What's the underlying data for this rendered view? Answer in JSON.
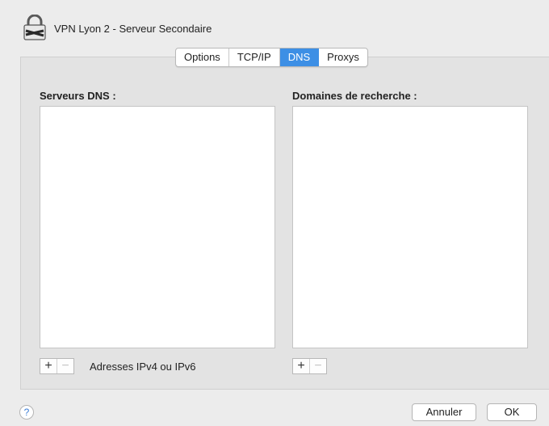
{
  "window": {
    "title": "VPN Lyon 2 - Serveur Secondaire"
  },
  "tabs": [
    {
      "label": "Options",
      "active": false
    },
    {
      "label": "TCP/IP",
      "active": false
    },
    {
      "label": "DNS",
      "active": true
    },
    {
      "label": "Proxys",
      "active": false
    }
  ],
  "dns_servers": {
    "label": "Serveurs DNS :",
    "items": [],
    "add_symbol": "+",
    "remove_symbol": "−",
    "hint": "Adresses IPv4 ou IPv6"
  },
  "search_domains": {
    "label": "Domaines de recherche :",
    "items": [],
    "add_symbol": "+",
    "remove_symbol": "−"
  },
  "footer": {
    "help_symbol": "?",
    "cancel_label": "Annuler",
    "ok_label": "OK"
  },
  "colors": {
    "accent": "#3d8fe5",
    "background": "#ececec",
    "pane": "#e3e3e3"
  }
}
